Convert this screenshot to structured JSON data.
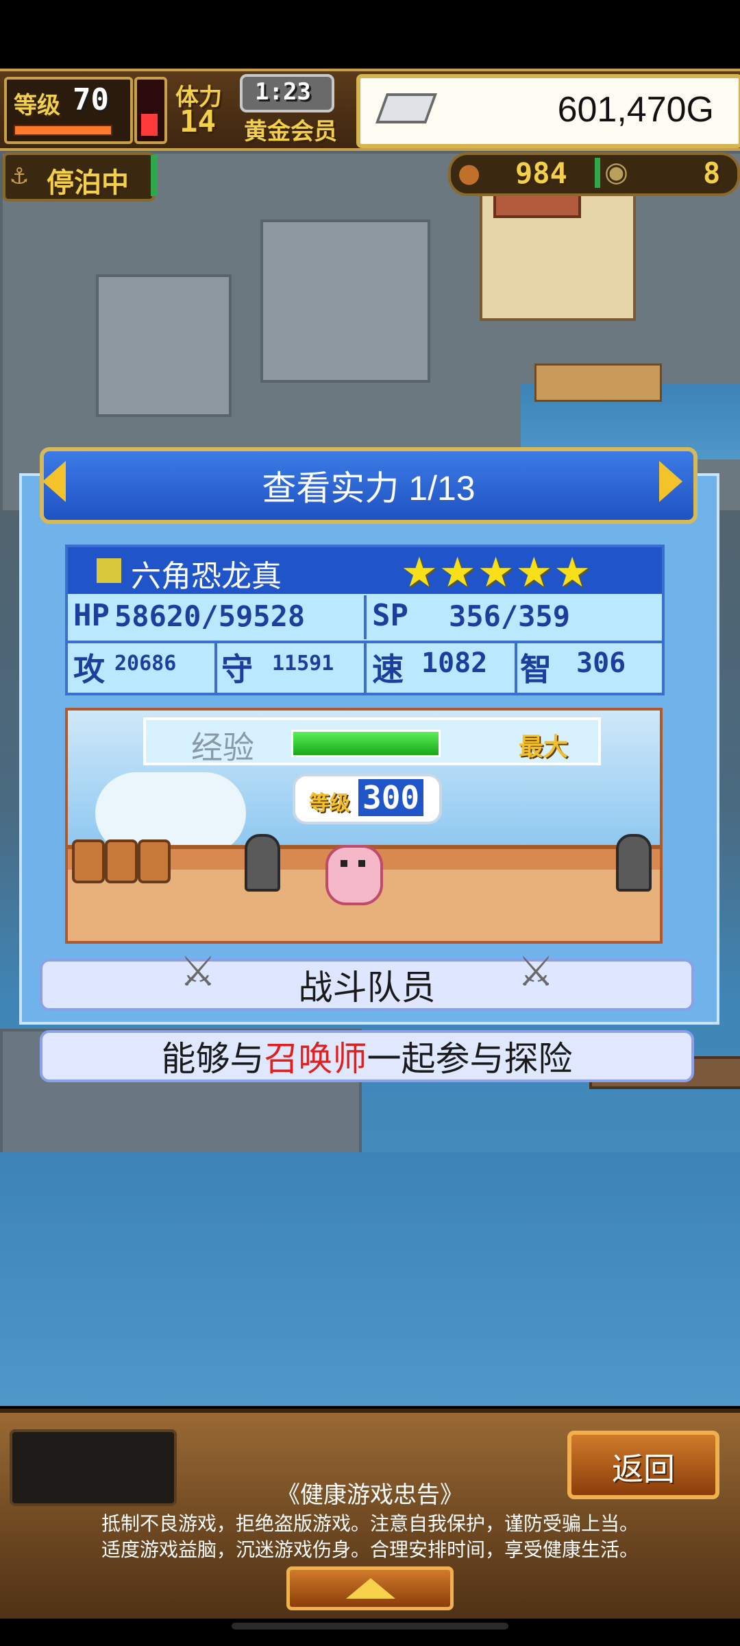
{
  "hud": {
    "level_label": "等级",
    "level_value": "70",
    "stamina_label": "体力",
    "stamina_value": "14",
    "timer": "1:23",
    "member_label": "黄金会员",
    "gold": "601,470G",
    "status": "停泊中",
    "food_count": "984",
    "medal_count": "8"
  },
  "panel": {
    "title": "查看实力 1/13",
    "name": "六角恐龙真",
    "stars": 5,
    "hp_label": "HP",
    "hp_value": "58620/59528",
    "sp_label": "SP",
    "sp_value": "356/359",
    "atk_label": "攻",
    "atk_value": "20686",
    "def_label": "守",
    "def_value": "11591",
    "spd_label": "速",
    "spd_value": "1082",
    "int_label": "智",
    "int_value": "306",
    "exp_label": "经验",
    "exp_fill": 1.0,
    "exp_max": "最大",
    "level_label": "等级",
    "level_value": "300",
    "role": "战斗队员",
    "desc_prefix": "能够与",
    "desc_highlight": "召唤师",
    "desc_suffix": "一起参与探险"
  },
  "bottom": {
    "back_label": "返回",
    "notice_title": "《健康游戏忠告》",
    "notice_line1": "抵制不良游戏，拒绝盗版游戏。注意自我保护，谨防受骗上当。",
    "notice_line2": "适度游戏益脑，沉迷游戏伤身。合理安排时间，享受健康生活。"
  },
  "colors": {
    "highlight": "#e0201c",
    "gold_border": "#c8a04a",
    "panel_blue": "#1f55c8"
  }
}
